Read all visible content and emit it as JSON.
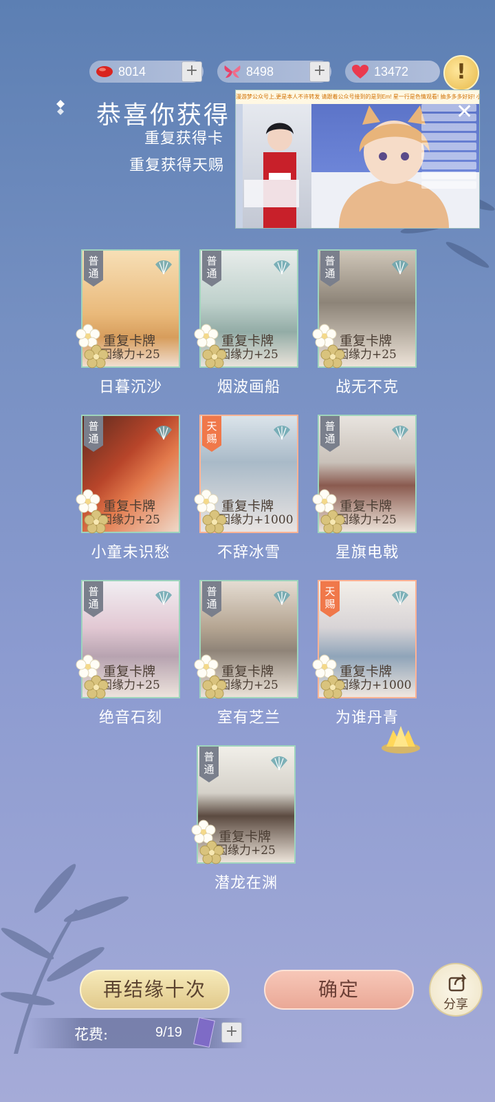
{
  "currencies": [
    {
      "icon": "red-bean-icon",
      "value": "8014"
    },
    {
      "icon": "butterfly-icon",
      "value": "8498"
    },
    {
      "icon": "heart-icon",
      "value": "13472"
    }
  ],
  "header": {
    "title": "恭喜你获得",
    "subtitle1": "重复获得卡",
    "subtitle2": "重复获得天赐"
  },
  "stream_overlay": {
    "banner": "漫游梦公众号上,更是本人不许转发  请跟着公众号接到的是到Em!  星一行是色情观看!  抽多多多好好!  小"
  },
  "cards": [
    {
      "rarity": "普通",
      "line1": "重复卡牌",
      "line2": "因缘力+25",
      "name": "日暮沉沙",
      "rare": false,
      "art": "desert"
    },
    {
      "rarity": "普通",
      "line1": "重复卡牌",
      "line2": "因缘力+25",
      "name": "烟波画船",
      "rare": false,
      "art": "lake"
    },
    {
      "rarity": "普通",
      "line1": "重复卡牌",
      "line2": "因缘力+25",
      "name": "战无不克",
      "rare": false,
      "art": "palace"
    },
    {
      "rarity": "普通",
      "line1": "重复卡牌",
      "line2": "因缘力+25",
      "name": "小童未识愁",
      "rare": false,
      "art": "fire"
    },
    {
      "rarity": "天赐",
      "line1": "重复卡牌",
      "line2": "因缘力+1000",
      "name": "不辞冰雪",
      "rare": true,
      "art": "snow"
    },
    {
      "rarity": "普通",
      "line1": "重复卡牌",
      "line2": "因缘力+25",
      "name": "星旗电戟",
      "rare": false,
      "art": "banner"
    },
    {
      "rarity": "普通",
      "line1": "重复卡牌",
      "line2": "因缘力+25",
      "name": "绝音石刻",
      "rare": false,
      "art": "blossom"
    },
    {
      "rarity": "普通",
      "line1": "重复卡牌",
      "line2": "因缘力+25",
      "name": "室有芝兰",
      "rare": false,
      "art": "room"
    },
    {
      "rarity": "天赐",
      "line1": "重复卡牌",
      "line2": "因缘力+1000",
      "name": "为谁丹青",
      "rare": true,
      "art": "scholar"
    },
    {
      "rarity": "普通",
      "line1": "重复卡牌",
      "line2": "因缘力+25",
      "name": "潜龙在渊",
      "rare": false,
      "art": "portrait"
    }
  ],
  "buttons": {
    "again": "再结缘十次",
    "confirm": "确定",
    "share": "分享"
  },
  "cost": {
    "label": "花费:",
    "value": "9/19"
  }
}
